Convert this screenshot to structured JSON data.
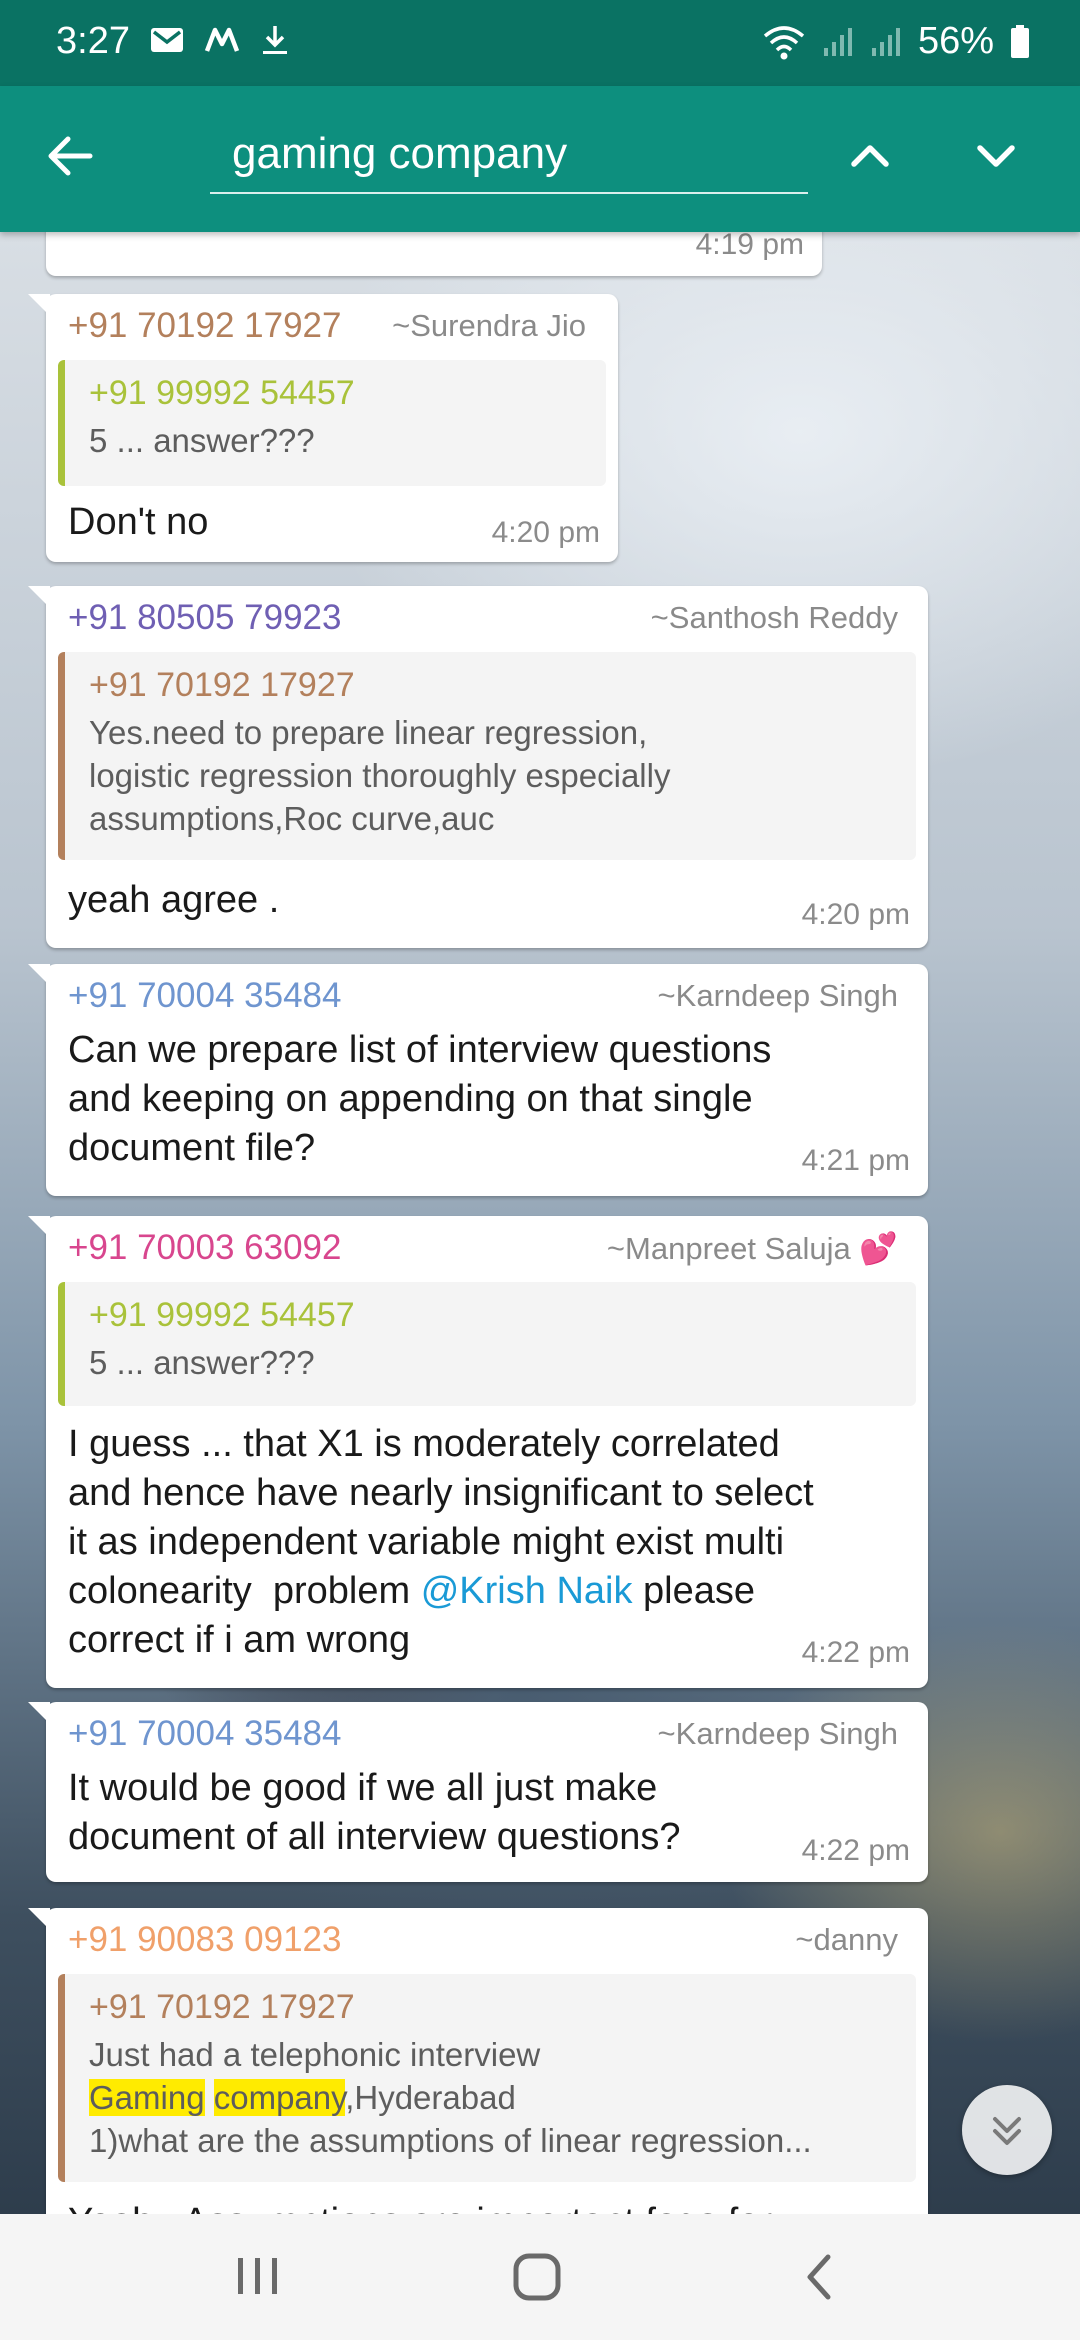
{
  "status_bar": {
    "time": "3:27",
    "battery": "56%",
    "icons": [
      "gmail-icon",
      "m-app-icon",
      "download-icon",
      "wifi-icon",
      "signal-icon",
      "signal-icon",
      "battery-icon"
    ]
  },
  "search": {
    "query": "gaming company"
  },
  "partial_top": {
    "time": "4:19 pm"
  },
  "messages": [
    {
      "sender": "+91 70192 17927",
      "alias": "~Surendra Jio",
      "quote": {
        "name": "+91 99992 54457",
        "text": "5 ... answer???"
      },
      "text": "Don't no",
      "time": "4:20 pm"
    },
    {
      "sender": "+91 80505 79923",
      "alias": "~Santhosh Reddy",
      "quote": {
        "name": "+91 70192 17927",
        "lines": [
          "Yes.need to prepare linear regression,",
          "logistic regression thoroughly especially",
          "assumptions,Roc curve,auc"
        ]
      },
      "text": "yeah agree .",
      "time": "4:20 pm"
    },
    {
      "sender": "+91 70004 35484",
      "alias": "~Karndeep Singh",
      "lines": [
        "Can we prepare list of interview questions",
        "and keeping on appending on that single",
        "document file?"
      ],
      "time": "4:21 pm"
    },
    {
      "sender": "+91 70003 63092",
      "alias": "~Manpreet Saluja 💕",
      "quote": {
        "name": "+91 99992 54457",
        "text": "5 ... answer???"
      },
      "lines": [
        "I guess ... that X1 is moderately correlated",
        "and hence have nearly insignificant to select",
        "it as independent variable might exist multi"
      ],
      "line4_before": "colonearity  problem ",
      "mention": "@Krish Naik",
      "line4_after": " please",
      "line5": "correct if i am wrong",
      "time": "4:22 pm"
    },
    {
      "sender": "+91 70004 35484",
      "alias": "~Karndeep Singh",
      "lines": [
        "It would be good if we all just make",
        "document of all interview questions?"
      ],
      "time": "4:22 pm"
    },
    {
      "sender": "+91 90083 09123",
      "alias": "~danny",
      "quote": {
        "name": "+91 70192 17927",
        "line1": "Just had a telephonic interview",
        "hl1": "Gaming",
        "hl2": "company",
        "line2_rest": ",Hyderabad",
        "line3": "1)what are the assumptions of linear regression..."
      },
      "cut_text": "Yeah.. Assumptions are important fags for"
    }
  ],
  "colors": {
    "status_bar": "#0a7263",
    "app_bar": "#0d8f7e",
    "highlight": "#ffeb00",
    "mention": "#1a9ad6"
  }
}
